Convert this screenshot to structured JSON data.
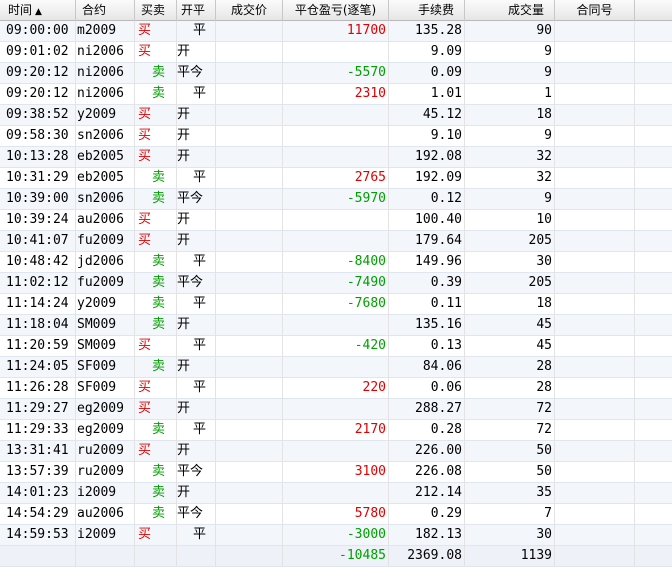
{
  "columns": {
    "time": "时间",
    "sort_indicator": "▲",
    "contract": "合约",
    "side": "买卖",
    "open_close": "开平",
    "price": "成交价",
    "pnl": "平仓盈亏(逐笔)",
    "fee": "手续费",
    "volume": "成交量",
    "contract_no": "合同号"
  },
  "colors": {
    "buy": "#e00000",
    "sell": "#00a000",
    "profit": "#e00000",
    "loss": "#00a000"
  },
  "rows": [
    {
      "time": "09:00:00",
      "code": "m2009",
      "side": "买",
      "oc": "平",
      "pnl": "11700",
      "fee": "135.28",
      "vol": "90"
    },
    {
      "time": "09:01:02",
      "code": "ni2006",
      "side": "买",
      "oc": "开",
      "pnl": "",
      "fee": "9.09",
      "vol": "9"
    },
    {
      "time": "09:20:12",
      "code": "ni2006",
      "side": "卖",
      "oc": "平今",
      "pnl": "-5570",
      "fee": "0.09",
      "vol": "9"
    },
    {
      "time": "09:20:12",
      "code": "ni2006",
      "side": "卖",
      "oc": "平",
      "pnl": "2310",
      "fee": "1.01",
      "vol": "1"
    },
    {
      "time": "09:38:52",
      "code": "y2009",
      "side": "买",
      "oc": "开",
      "pnl": "",
      "fee": "45.12",
      "vol": "18"
    },
    {
      "time": "09:58:30",
      "code": "sn2006",
      "side": "买",
      "oc": "开",
      "pnl": "",
      "fee": "9.10",
      "vol": "9"
    },
    {
      "time": "10:13:28",
      "code": "eb2005",
      "side": "买",
      "oc": "开",
      "pnl": "",
      "fee": "192.08",
      "vol": "32"
    },
    {
      "time": "10:31:29",
      "code": "eb2005",
      "side": "卖",
      "oc": "平",
      "pnl": "2765",
      "fee": "192.09",
      "vol": "32"
    },
    {
      "time": "10:39:00",
      "code": "sn2006",
      "side": "卖",
      "oc": "平今",
      "pnl": "-5970",
      "fee": "0.12",
      "vol": "9"
    },
    {
      "time": "10:39:24",
      "code": "au2006",
      "side": "买",
      "oc": "开",
      "pnl": "",
      "fee": "100.40",
      "vol": "10"
    },
    {
      "time": "10:41:07",
      "code": "fu2009",
      "side": "买",
      "oc": "开",
      "pnl": "",
      "fee": "179.64",
      "vol": "205"
    },
    {
      "time": "10:48:42",
      "code": "jd2006",
      "side": "卖",
      "oc": "平",
      "pnl": "-8400",
      "fee": "149.96",
      "vol": "30"
    },
    {
      "time": "11:02:12",
      "code": "fu2009",
      "side": "卖",
      "oc": "平今",
      "pnl": "-7490",
      "fee": "0.39",
      "vol": "205"
    },
    {
      "time": "11:14:24",
      "code": "y2009",
      "side": "卖",
      "oc": "平",
      "pnl": "-7680",
      "fee": "0.11",
      "vol": "18"
    },
    {
      "time": "11:18:04",
      "code": "SM009",
      "side": "卖",
      "oc": "开",
      "pnl": "",
      "fee": "135.16",
      "vol": "45"
    },
    {
      "time": "11:20:59",
      "code": "SM009",
      "side": "买",
      "oc": "平",
      "pnl": "-420",
      "fee": "0.13",
      "vol": "45"
    },
    {
      "time": "11:24:05",
      "code": "SF009",
      "side": "卖",
      "oc": "开",
      "pnl": "",
      "fee": "84.06",
      "vol": "28"
    },
    {
      "time": "11:26:28",
      "code": "SF009",
      "side": "买",
      "oc": "平",
      "pnl": "220",
      "fee": "0.06",
      "vol": "28"
    },
    {
      "time": "11:29:27",
      "code": "eg2009",
      "side": "买",
      "oc": "开",
      "pnl": "",
      "fee": "288.27",
      "vol": "72"
    },
    {
      "time": "11:29:33",
      "code": "eg2009",
      "side": "卖",
      "oc": "平",
      "pnl": "2170",
      "fee": "0.28",
      "vol": "72"
    },
    {
      "time": "13:31:41",
      "code": "ru2009",
      "side": "买",
      "oc": "开",
      "pnl": "",
      "fee": "226.00",
      "vol": "50"
    },
    {
      "time": "13:57:39",
      "code": "ru2009",
      "side": "卖",
      "oc": "平今",
      "pnl": "3100",
      "fee": "226.08",
      "vol": "50"
    },
    {
      "time": "14:01:23",
      "code": "i2009",
      "side": "卖",
      "oc": "开",
      "pnl": "",
      "fee": "212.14",
      "vol": "35"
    },
    {
      "time": "14:54:29",
      "code": "au2006",
      "side": "卖",
      "oc": "平今",
      "pnl": "5780",
      "fee": "0.29",
      "vol": "7"
    },
    {
      "time": "14:59:53",
      "code": "i2009",
      "side": "买",
      "oc": "平",
      "pnl": "-3000",
      "fee": "182.13",
      "vol": "30"
    }
  ],
  "totals": {
    "pnl": "-10485",
    "fee": "2369.08",
    "volume": "1139"
  }
}
